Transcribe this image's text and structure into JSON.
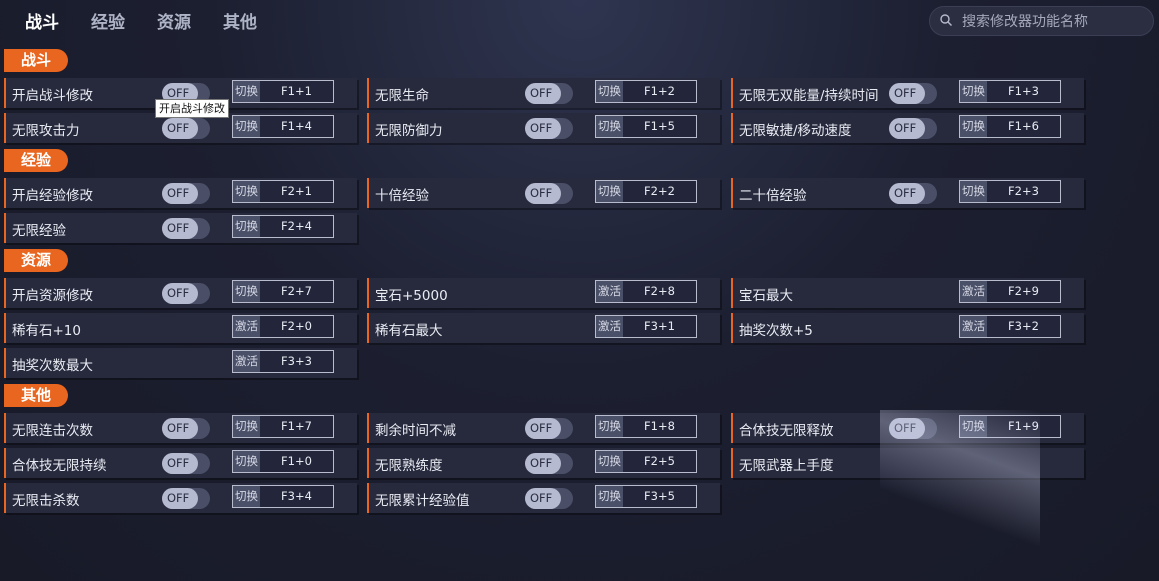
{
  "tabs": [
    "战斗",
    "经验",
    "资源",
    "其他"
  ],
  "search": {
    "placeholder": "搜索修改器功能名称"
  },
  "tooltip": "开启战斗修改",
  "sections": [
    {
      "title": "战斗",
      "items": [
        {
          "label": "开启战斗修改",
          "toggle": "OFF",
          "mode": "切换",
          "hotkey": "F1+1"
        },
        {
          "label": "无限生命",
          "toggle": "OFF",
          "mode": "切换",
          "hotkey": "F1+2"
        },
        {
          "label": "无限无双能量/持续时间",
          "toggle": "OFF",
          "mode": "切换",
          "hotkey": "F1+3"
        },
        {
          "label": "无限攻击力",
          "toggle": "OFF",
          "mode": "切换",
          "hotkey": "F1+4"
        },
        {
          "label": "无限防御力",
          "toggle": "OFF",
          "mode": "切换",
          "hotkey": "F1+5"
        },
        {
          "label": "无限敏捷/移动速度",
          "toggle": "OFF",
          "mode": "切换",
          "hotkey": "F1+6"
        }
      ]
    },
    {
      "title": "经验",
      "items": [
        {
          "label": "开启经验修改",
          "toggle": "OFF",
          "mode": "切换",
          "hotkey": "F2+1"
        },
        {
          "label": "十倍经验",
          "toggle": "OFF",
          "mode": "切换",
          "hotkey": "F2+2"
        },
        {
          "label": "二十倍经验",
          "toggle": "OFF",
          "mode": "切换",
          "hotkey": "F2+3"
        },
        {
          "label": "无限经验",
          "toggle": "OFF",
          "mode": "切换",
          "hotkey": "F2+4"
        }
      ]
    },
    {
      "title": "资源",
      "items": [
        {
          "label": "开启资源修改",
          "toggle": "OFF",
          "mode": "切换",
          "hotkey": "F2+7"
        },
        {
          "label": "宝石+5000",
          "toggle": null,
          "mode": "激活",
          "hotkey": "F2+8"
        },
        {
          "label": "宝石最大",
          "toggle": null,
          "mode": "激活",
          "hotkey": "F2+9"
        },
        {
          "label": "稀有石+10",
          "toggle": null,
          "mode": "激活",
          "hotkey": "F2+0"
        },
        {
          "label": "稀有石最大",
          "toggle": null,
          "mode": "激活",
          "hotkey": "F3+1"
        },
        {
          "label": "抽奖次数+5",
          "toggle": null,
          "mode": "激活",
          "hotkey": "F3+2"
        },
        {
          "label": "抽奖次数最大",
          "toggle": null,
          "mode": "激活",
          "hotkey": "F3+3"
        }
      ]
    },
    {
      "title": "其他",
      "items": [
        {
          "label": "无限连击次数",
          "toggle": "OFF",
          "mode": "切换",
          "hotkey": "F1+7"
        },
        {
          "label": "剩余时间不减",
          "toggle": "OFF",
          "mode": "切换",
          "hotkey": "F1+8"
        },
        {
          "label": "合体技无限释放",
          "toggle": "OFF",
          "mode": "切换",
          "hotkey": "F1+9"
        },
        {
          "label": "合体技无限持续",
          "toggle": "OFF",
          "mode": "切换",
          "hotkey": "F1+0"
        },
        {
          "label": "无限熟练度",
          "toggle": "OFF",
          "mode": "切换",
          "hotkey": "F2+5"
        },
        {
          "label": "无限武器上手度",
          "toggle": null,
          "mode": null,
          "hotkey": null
        },
        {
          "label": "无限击杀数",
          "toggle": "OFF",
          "mode": "切换",
          "hotkey": "F3+4"
        },
        {
          "label": "无限累计经验值",
          "toggle": "OFF",
          "mode": "切换",
          "hotkey": "F3+5"
        }
      ]
    }
  ]
}
